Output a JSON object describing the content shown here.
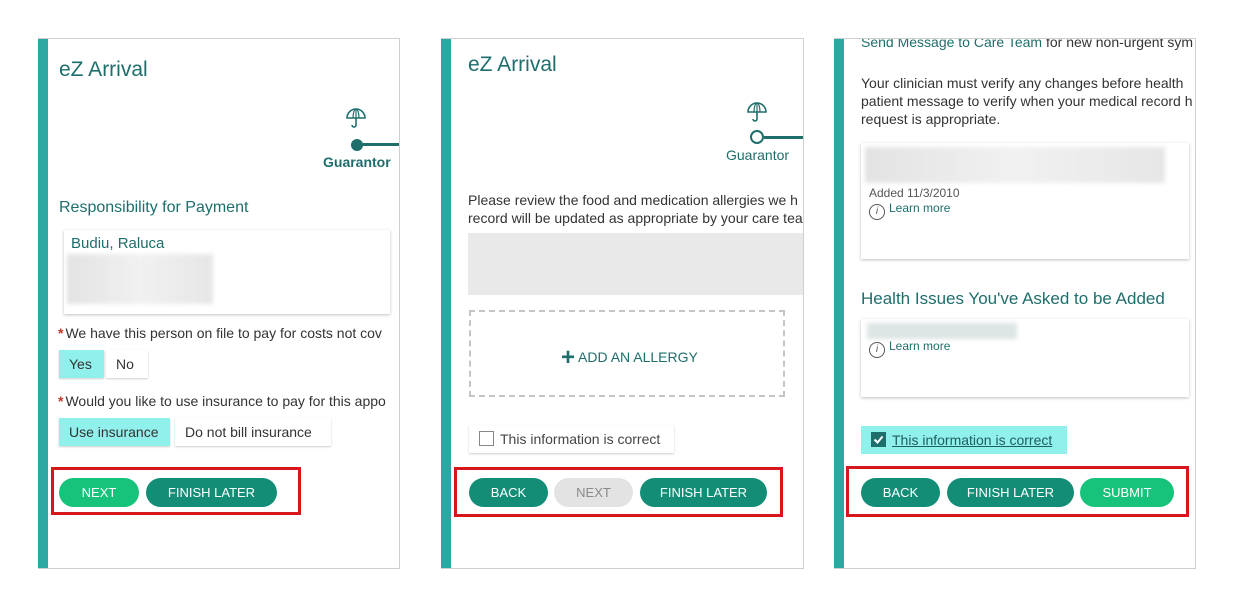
{
  "panel1": {
    "app_title": "eZ Arrival",
    "step_label": "Guarantor",
    "section_title": "Responsibility for Payment",
    "guarantor_name": "Budiu, Raluca",
    "question1": "We have this person on file to pay for costs not cov",
    "q1_yes": "Yes",
    "q1_no": "No",
    "question2": "Would you like to use insurance to pay for this appo",
    "q2_use": "Use insurance",
    "q2_dont": "Do not bill insurance",
    "next_label": "NEXT",
    "finish_label": "FINISH LATER"
  },
  "panel2": {
    "app_title": "eZ Arrival",
    "step_label": "Guarantor",
    "instructions_line1": "Please review the food and medication allergies we h",
    "instructions_line2": "record will be updated as appropriate by your care tea",
    "add_allergy_label": "ADD AN ALLERGY",
    "confirm_label": "This information is correct",
    "back_label": "BACK",
    "next_label": "NEXT",
    "finish_label": "FINISH LATER"
  },
  "panel3": {
    "top_link": "Send Message to Care Team",
    "top_text": " for new non-urgent sym",
    "para_line1": "Your clinician must verify any changes before health",
    "para_line2": "patient message to verify when your medical record h",
    "para_line3": "request is appropriate.",
    "added_date": "Added 11/3/2010",
    "learn_more_1": "Learn more",
    "section_title": "Health Issues You've Asked to be Added",
    "learn_more_2": "Learn more",
    "confirm_label": "This information is correct",
    "back_label": "BACK",
    "finish_label": "FINISH LATER",
    "submit_label": "SUBMIT"
  },
  "colors": {
    "accent_teal": "#1e6e6c",
    "button_teal": "#138d76",
    "button_green": "#17c27a",
    "selected_cyan": "#8ff0ec",
    "highlight_red": "#d6181c",
    "stripe": "#2ea6a2"
  }
}
